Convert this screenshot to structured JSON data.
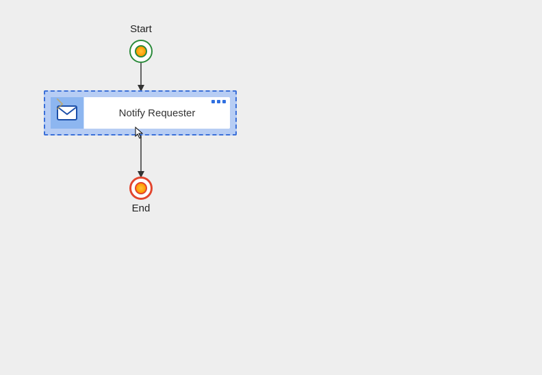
{
  "nodes": {
    "start": {
      "label": "Start"
    },
    "activity": {
      "label": "Notify Requester"
    },
    "end": {
      "label": "End"
    }
  },
  "icons": {
    "activity": "mail-icon",
    "menu": "ellipsis-icon"
  }
}
